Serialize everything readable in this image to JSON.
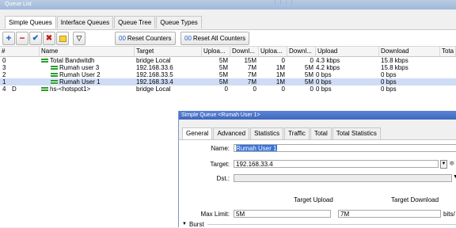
{
  "window": {
    "title": "Queue List"
  },
  "tabs": [
    "Simple Queues",
    "Interface Queues",
    "Queue Tree",
    "Queue Types"
  ],
  "toolbar": {
    "add_icon": "+",
    "remove_icon": "−",
    "enable_icon": "✔",
    "disable_icon": "✖",
    "comment_icon": "",
    "filter_icon": "▽",
    "reset_counters": "Reset Counters",
    "reset_all_counters": "Reset All Counters",
    "reset_icon": "00"
  },
  "table": {
    "columns": [
      "#",
      "Name",
      "Target",
      "Uploa...",
      "Downl...",
      "Uploa...",
      "Downl...",
      "Upload",
      "Download",
      "Tota"
    ],
    "rows": [
      {
        "num": "0",
        "flag": "",
        "name": "Total Bandwitdh",
        "target": "bridge Local",
        "c1": "5M",
        "c2": "15M",
        "c3": "0",
        "c4": "0",
        "upload": "4.3 kbps",
        "download": "15.8 kbps",
        "selected": false,
        "indent": 0
      },
      {
        "num": "3",
        "flag": "",
        "name": "Rumah user 3",
        "target": "192.168.33.6",
        "c1": "5M",
        "c2": "7M",
        "c3": "1M",
        "c4": "5M",
        "upload": "4.2 kbps",
        "download": "15.8 kbps",
        "selected": false,
        "indent": 1
      },
      {
        "num": "2",
        "flag": "",
        "name": "Rumah User 2",
        "target": "192.168.33.5",
        "c1": "5M",
        "c2": "7M",
        "c3": "1M",
        "c4": "5M",
        "upload": "0 bps",
        "download": "0 bps",
        "selected": false,
        "indent": 1
      },
      {
        "num": "1",
        "flag": "",
        "name": "Rumah User 1",
        "target": "192.168.33.4",
        "c1": "5M",
        "c2": "7M",
        "c3": "1M",
        "c4": "5M",
        "upload": "0 bps",
        "download": "0 bps",
        "selected": true,
        "indent": 1
      },
      {
        "num": "4",
        "flag": "D",
        "name": "hs-<hotspot1>",
        "target": "bridge Local",
        "c1": "0",
        "c2": "0",
        "c3": "0",
        "c4": "0",
        "upload": "0 bps",
        "download": "0 bps",
        "selected": false,
        "indent": 0
      }
    ]
  },
  "dialog": {
    "title": "Simple Queue <Rumah User 1>",
    "tabs": [
      "General",
      "Advanced",
      "Statistics",
      "Traffic",
      "Total",
      "Total Statistics"
    ],
    "name_label": "Name:",
    "name_value": "Rumah User 1",
    "target_label": "Target:",
    "target_value": "192.168.33.4",
    "dst_label": "Dst.:",
    "dst_value": "",
    "target_upload_label": "Target Upload",
    "target_download_label": "Target Download",
    "max_limit_label": "Max Limit:",
    "max_upload": "5M",
    "max_download": "7M",
    "units": "bits/",
    "burst_label": "Burst"
  }
}
